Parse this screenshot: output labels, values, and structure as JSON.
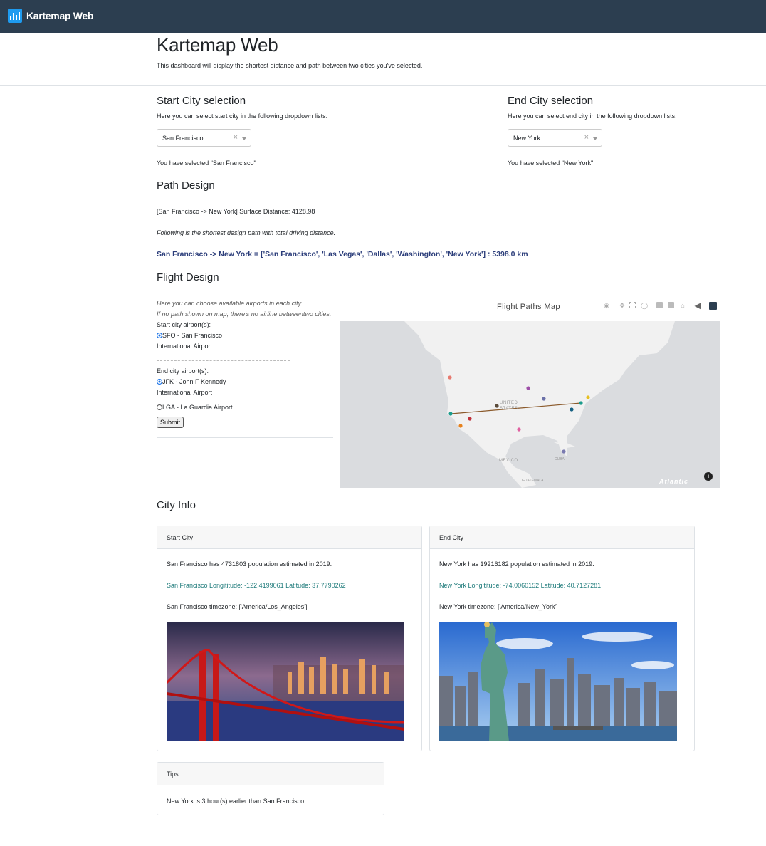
{
  "navbar": {
    "brand": "Kartemap Web"
  },
  "header": {
    "title": "Kartemap Web",
    "subtitle": "This dashboard will display the shortest distance and path between two cities you've selected."
  },
  "start": {
    "heading": "Start City selection",
    "hint": "Here you can select start city in the following dropdown lists.",
    "value": "San Francisco",
    "clear": "×",
    "selected_msg": "You have selected \"San Francisco\""
  },
  "end": {
    "heading": "End City selection",
    "hint": "Here you can select end city in the following dropdown lists.",
    "value": "New York",
    "clear": "×",
    "selected_msg": "You have selected \"New York\""
  },
  "path": {
    "heading": "Path Design",
    "surface": "[San Francisco -> New York] Surface Distance: 4128.98",
    "note": "Following is the shortest design path with total driving distance.",
    "result": "San Francisco -> New York = ['San Francisco', 'Las Vegas', 'Dallas', 'Washington', 'New York'] : 5398.0 km"
  },
  "flight": {
    "heading": "Flight Design",
    "hint1": "Here you can choose available airports in each city.",
    "hint2": "If no path shown on map, there's no airline betweentwo cities.",
    "start_label": "Start city airport(s):",
    "start_opt1a": "SFO - San Francisco",
    "start_opt1b": "International Airport",
    "end_label": "End city airport(s):",
    "end_opt1a": "JFK - John F Kennedy",
    "end_opt1b": "International Airport",
    "end_opt2": "LGA - La Guardia Airport",
    "submit": "Submit",
    "map_title": "Flight Paths Map",
    "map_labels": {
      "us1": "UNITED",
      "us2": "STATES",
      "mexico": "MEXICO",
      "cuba": "CUBA",
      "guatemala": "GUATEMALA",
      "atlantic": "Atlantic"
    },
    "info": "i"
  },
  "cityinfo": {
    "heading": "City Info",
    "start_card": {
      "title": "Start City",
      "population": "San Francisco has 4731803 population estimated in 2019.",
      "coords": "San Francisco Longititude: -122.4199061 Latitude: 37.7790262",
      "timezone": "San Francisco timezone: ['America/Los_Angeles']"
    },
    "end_card": {
      "title": "End City",
      "population": "New York has 19216182 population estimated in 2019.",
      "coords": "New York Longititude: -74.0060152 Latitude: 40.7127281",
      "timezone": "New York timezone: ['America/New_York']"
    },
    "tips": {
      "title": "Tips",
      "text": "New York is 3 hour(s) earlier than San Francisco."
    }
  },
  "colors": {
    "navbar": "#2c3e50",
    "path_text": "#2b3d7a",
    "coords_text": "#1d7a7a",
    "route_line": "#8b5a2b"
  }
}
